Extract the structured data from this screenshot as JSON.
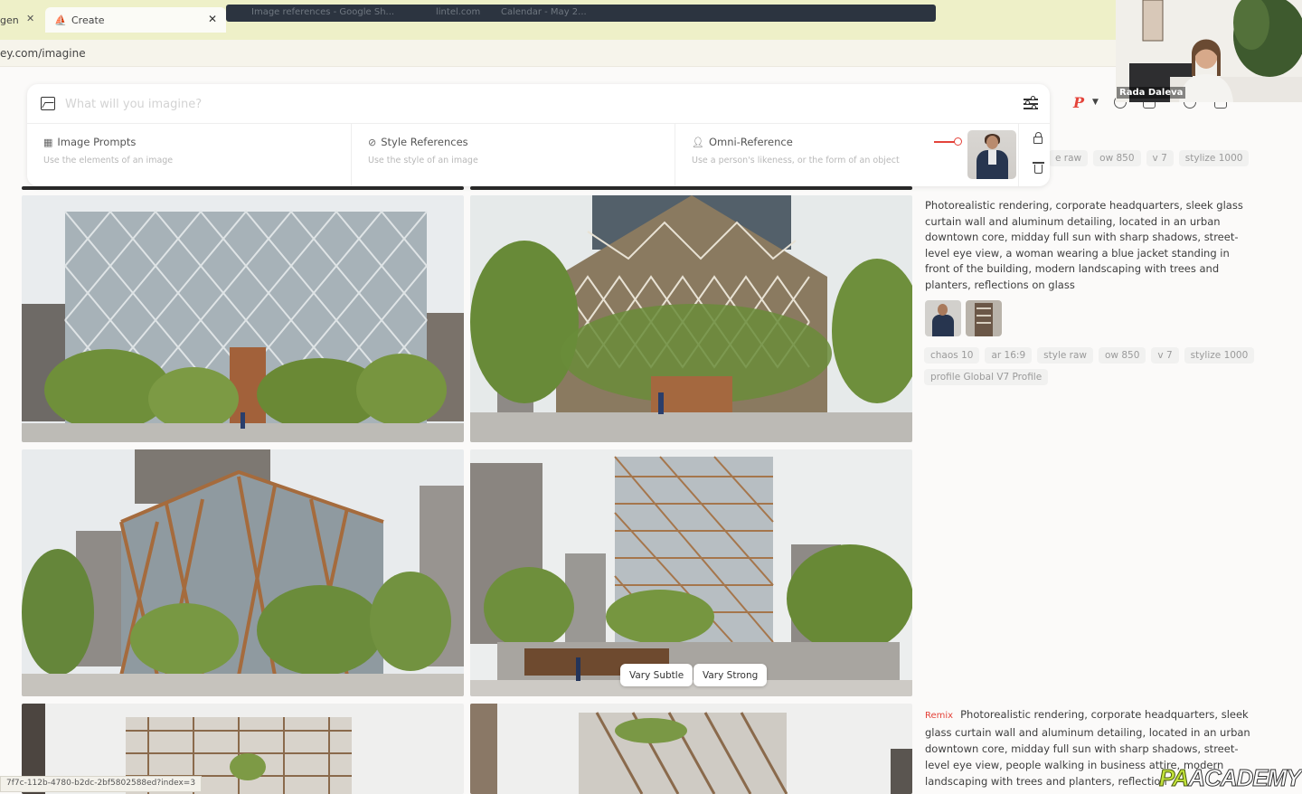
{
  "browser": {
    "prev_tab_label": "gen",
    "tab_label": "Create",
    "address": "ey.com/imagine",
    "other_tabs": [
      "Image references - Google Sh...",
      "lintel.com",
      "Calendar - May 2..."
    ]
  },
  "prompt": {
    "placeholder": "What will you imagine?"
  },
  "references": {
    "image_prompts_title": "Image Prompts",
    "image_prompts_sub": "Use the elements of an image",
    "style_refs_title": "Style References",
    "style_refs_sub": "Use the style of an image",
    "omni_title": "Omni-Reference",
    "omni_sub": "Use a person's likeness, or the form of an object"
  },
  "nav": {
    "profile_letter": "P"
  },
  "job_top_chips": [
    "e raw",
    "ow 850",
    "v 7",
    "stylize 1000"
  ],
  "job": {
    "description": "Photorealistic rendering, corporate headquarters, sleek glass curtain wall and aluminum detailing, located in an urban downtown core, midday full sun with sharp shadows, street-level eye view, a woman wearing a blue jacket standing in front of the building, modern landscaping with trees and planters, reflections on glass",
    "chips": [
      "chaos 10",
      "ar 16:9",
      "style raw",
      "ow 850",
      "v 7",
      "stylize 1000"
    ],
    "profile_chip": "profile Global V7 Profile"
  },
  "vary": {
    "subtle": "Vary Subtle",
    "strong": "Vary Strong"
  },
  "remix": {
    "tag": "Remix",
    "description": "Photorealistic rendering, corporate headquarters, sleek glass curtain wall and aluminum detailing, located in an urban downtown core, midday full sun with sharp shadows, street-level eye view, people walking in business attire, modern landscaping with trees and planters, reflection"
  },
  "webcam": {
    "name": "Rada Daleva"
  },
  "status_url": "7f7c-112b-4780-b2dc-2bf5802588ed?index=3",
  "watermark": {
    "pa": "PA",
    "rest": "ACADEMY"
  },
  "colors": {
    "accent": "#e4433a",
    "chrome": "#eef0c8",
    "background": "#fbfaf9"
  },
  "icons": [
    "image-icon",
    "sliders-icon",
    "lock-icon",
    "trash-icon",
    "person-icon",
    "paperclip-icon",
    "grid-icon"
  ]
}
